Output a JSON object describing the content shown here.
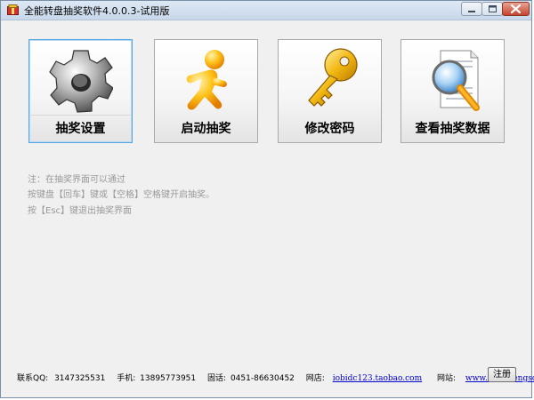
{
  "window": {
    "title": "全能转盘抽奖软件4.0.0.3-试用版"
  },
  "tiles": [
    {
      "label": "抽奖设置",
      "icon": "gear-icon",
      "selected": true
    },
    {
      "label": "启动抽奖",
      "icon": "running-man-icon",
      "selected": false
    },
    {
      "label": "修改密码",
      "icon": "key-icon",
      "selected": false
    },
    {
      "label": "查看抽奖数据",
      "icon": "magnifier-document-icon",
      "selected": false
    }
  ],
  "notes": [
    "注：在抽奖界面可以通过",
    "按键盘【回车】键或【空格】空格键开启抽奖。",
    "按【Esc】键退出抽奖界面"
  ],
  "footer": {
    "qq_label": "联系QQ:",
    "qq_value": "3147325531",
    "phone_label": "手机:",
    "phone_value": "13895773951",
    "tel_label": "固话:",
    "tel_value": "0451-86630452",
    "shop_label": "网店:",
    "shop_link": "iobidc123.taobao.com",
    "site_label": "网站:",
    "site_link": "www.quannengsoft.cn",
    "register_label": "注册"
  },
  "colors": {
    "selected_border": "#55a5e0",
    "link": "#0000cc",
    "note_text": "#9a9a9a"
  }
}
